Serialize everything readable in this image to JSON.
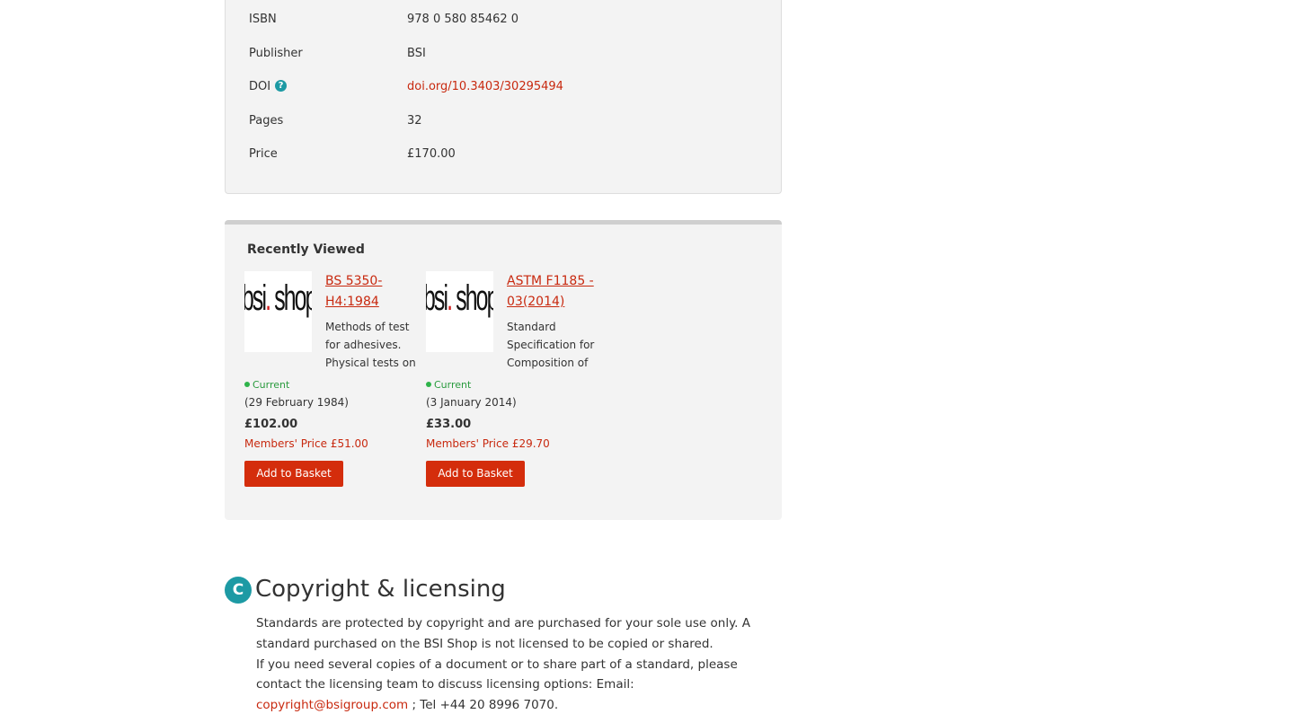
{
  "details": {
    "rows": [
      {
        "label": "ISBN",
        "value": "978 0 580 85462 0"
      },
      {
        "label": "Publisher",
        "value": "BSI"
      },
      {
        "label": "DOI",
        "value": "doi.org/10.3403/30295494"
      },
      {
        "label": "Pages",
        "value": "32"
      },
      {
        "label": "Price",
        "value": "£170.00"
      }
    ],
    "help_icon": "question-circle-icon",
    "help_glyph": "?"
  },
  "recently_viewed": {
    "title": "Recently Viewed",
    "products": [
      {
        "thumb_brand": "bsi",
        "thumb_dot": ".",
        "thumb_word": "shop",
        "code": "BS 5350-H4:1984",
        "description": "Methods of test for adhesives. Physical tests on",
        "status": "Current",
        "date": "(29 February 1984)",
        "price": "£102.00",
        "member_price": "Members' Price £51.00",
        "button": "Add to Basket"
      },
      {
        "thumb_brand": "bsi",
        "thumb_dot": ".",
        "thumb_word": "shop",
        "code": "ASTM F1185 - 03(2014)",
        "description": "Standard Specification for Composition of",
        "status": "Current",
        "date": "(3 January 2014)",
        "price": "£33.00",
        "member_price": "Members' Price £29.70",
        "button": "Add to Basket"
      }
    ]
  },
  "copyright": {
    "badge": "C",
    "title": "Copyright & licensing",
    "para1": "Standards are protected by copyright and are purchased for your sole use only. A standard purchased on the BSI Shop is not licensed to be copied or shared.",
    "para2_before": "If you need several copies of a document or to share part of a standard, please contact the licensing team to discuss licensing options: Email: ",
    "email": "copyright@bsigroup.com",
    "para2_after": " ; Tel +44 20 8996 7070."
  },
  "colors": {
    "accent_red": "#d42d0c",
    "link_red": "#c8290f",
    "teal": "#1d9aa4",
    "status_green": "#2eb34a",
    "panel_bg": "#f3f3f3"
  }
}
